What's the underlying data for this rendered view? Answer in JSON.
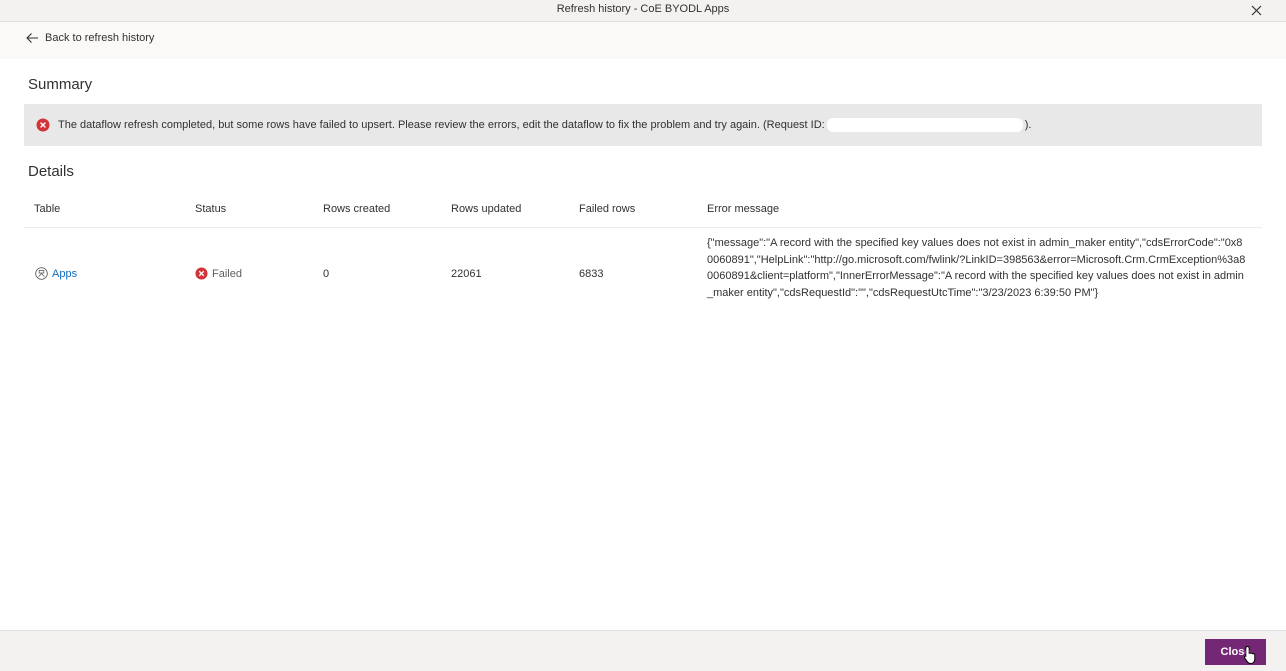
{
  "window": {
    "title": "Refresh history - CoE BYODL Apps"
  },
  "back_link": {
    "label": "Back to refresh history"
  },
  "summary": {
    "heading": "Summary",
    "banner_message": "The dataflow refresh completed, but some rows have failed to upsert. Please review the errors, edit the dataflow to fix the problem and try again. (Request ID:",
    "banner_suffix": ")."
  },
  "details": {
    "heading": "Details",
    "columns": [
      "Table",
      "Status",
      "Rows created",
      "Rows updated",
      "Failed rows",
      "Error message"
    ],
    "rows": [
      {
        "table": "Apps",
        "status": "Failed",
        "rows_created": "0",
        "rows_updated": "22061",
        "failed_rows": "6833",
        "error_message": "{\"message\":\"A record with the specified key values does not exist in admin_maker entity\",\"cdsErrorCode\":\"0x80060891\",\"HelpLink\":\"http://go.microsoft.com/fwlink/?LinkID=398563&error=Microsoft.Crm.CrmException%3a80060891&client=platform\",\"InnerErrorMessage\":\"A record with the specified key values does not exist in admin_maker entity\",\"cdsRequestId\":\"\",\"cdsRequestUtcTime\":\"3/23/2023 6:39:50 PM\"}"
      }
    ]
  },
  "footer": {
    "close_label": "Close"
  },
  "colors": {
    "accent": "#742774",
    "error": "#d13438",
    "link": "#0f6cbd"
  },
  "icons": {
    "window_close": "close-icon",
    "back": "arrow-left-icon",
    "error": "error-circle-icon",
    "table": "apps-icon"
  }
}
